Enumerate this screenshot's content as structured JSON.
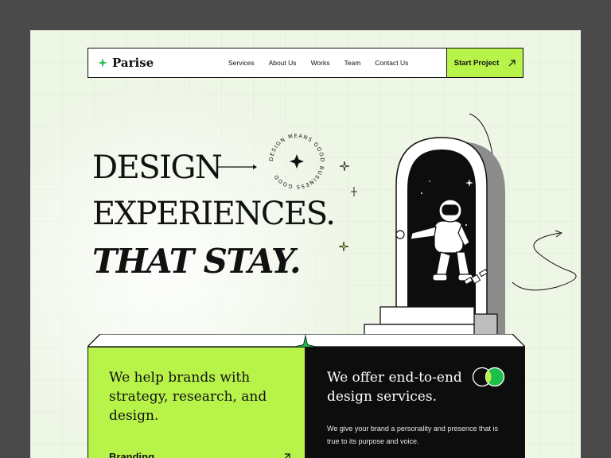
{
  "brand": {
    "name": "Parise",
    "accent": "#b8f34a",
    "dark": "#0d0d0d"
  },
  "nav": {
    "items": [
      "Services",
      "About Us",
      "Works",
      "Team",
      "Contact Us"
    ],
    "cta_label": "Start Project"
  },
  "hero": {
    "line1": "DESIGN",
    "line2": "EXPERIENCES.",
    "line3": "THAT STAY.",
    "badge_text": "DESIGN MEANS GOOD BUSINESS GOOD "
  },
  "card_left": {
    "lead": "We help brands with strategy, research, and design.",
    "tag": "Branding"
  },
  "card_right": {
    "lead": "We offer end-to-end design services.",
    "sub": "We give your brand a personality and presence that is true to its purpose and voice."
  }
}
